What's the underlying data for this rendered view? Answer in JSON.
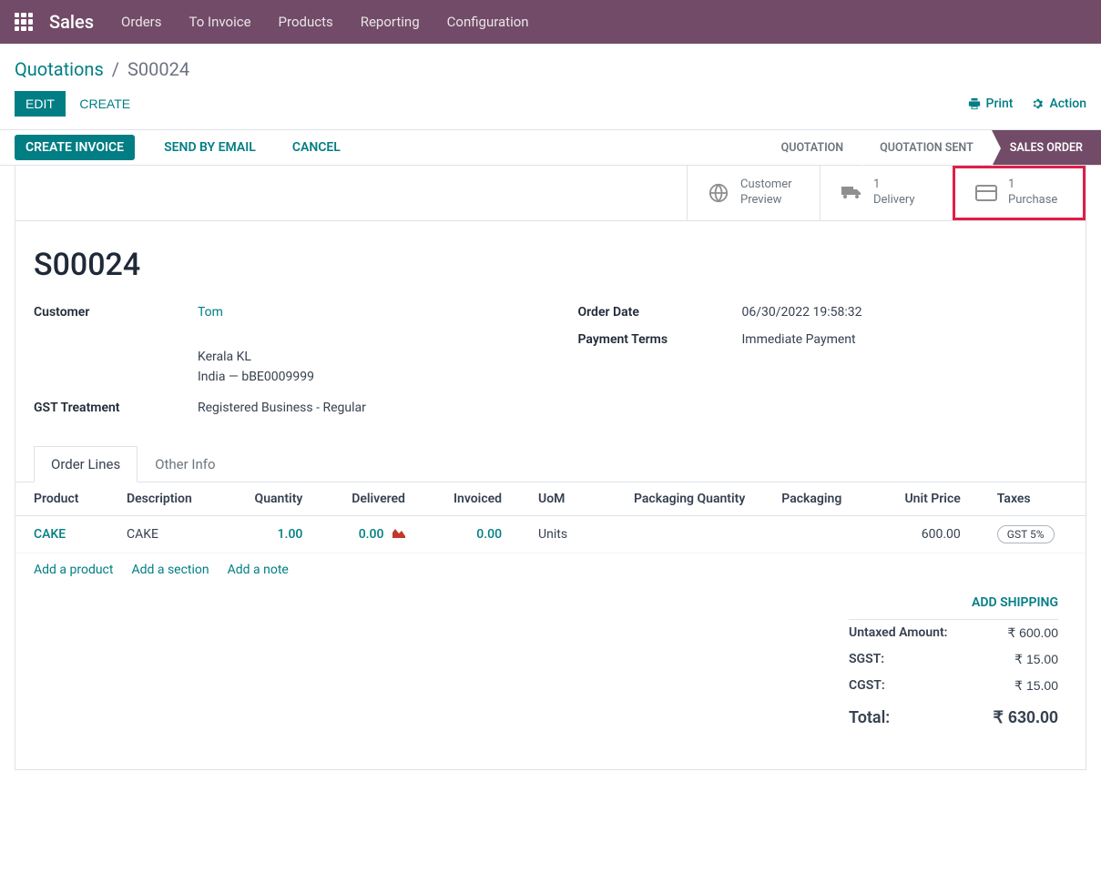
{
  "nav": {
    "brand": "Sales",
    "items": [
      "Orders",
      "To Invoice",
      "Products",
      "Reporting",
      "Configuration"
    ]
  },
  "breadcrumb": {
    "root": "Quotations",
    "current": "S00024"
  },
  "buttons": {
    "edit": "EDIT",
    "create": "CREATE",
    "print": "Print",
    "action": "Action",
    "create_invoice": "CREATE INVOICE",
    "send_email": "SEND BY EMAIL",
    "cancel": "CANCEL"
  },
  "status_steps": {
    "quotation": "QUOTATION",
    "sent": "QUOTATION SENT",
    "order": "SALES ORDER"
  },
  "stat_buttons": {
    "customer_preview_l1": "Customer",
    "customer_preview_l2": "Preview",
    "delivery_count": "1",
    "delivery_label": "Delivery",
    "purchase_count": "1",
    "purchase_label": "Purchase"
  },
  "doc": {
    "name": "S00024",
    "customer_label": "Customer",
    "customer_name": "Tom",
    "customer_addr1": "Kerala KL",
    "customer_addr2": "India — bBE0009999",
    "gst_label": "GST Treatment",
    "gst_value": "Registered Business - Regular",
    "order_date_label": "Order Date",
    "order_date_value": "06/30/2022 19:58:32",
    "payment_terms_label": "Payment Terms",
    "payment_terms_value": "Immediate Payment"
  },
  "tabs": {
    "order_lines": "Order Lines",
    "other_info": "Other Info"
  },
  "table": {
    "headers": {
      "product": "Product",
      "description": "Description",
      "quantity": "Quantity",
      "delivered": "Delivered",
      "invoiced": "Invoiced",
      "uom": "UoM",
      "pack_qty": "Packaging Quantity",
      "packaging": "Packaging",
      "unit_price": "Unit Price",
      "taxes": "Taxes"
    },
    "row": {
      "product": "CAKE",
      "description": "CAKE",
      "quantity": "1.00",
      "delivered": "0.00",
      "invoiced": "0.00",
      "uom": "Units",
      "unit_price": "600.00",
      "tax_badge": "GST 5%"
    },
    "add_product": "Add a product",
    "add_section": "Add a section",
    "add_note": "Add a note"
  },
  "totals": {
    "add_shipping": "ADD SHIPPING",
    "untaxed_label": "Untaxed Amount:",
    "untaxed_value": "₹ 600.00",
    "sgst_label": "SGST:",
    "sgst_value": "₹ 15.00",
    "cgst_label": "CGST:",
    "cgst_value": "₹ 15.00",
    "total_label": "Total:",
    "total_value": "₹ 630.00"
  }
}
